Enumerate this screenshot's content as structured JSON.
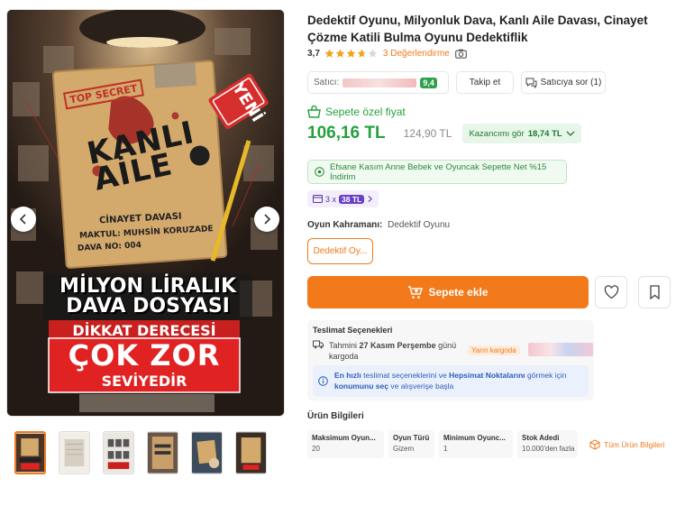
{
  "product": {
    "title": "Dedektif Oyunu, Milyonluk Dava, Kanlı Aile Davası, Cinayet Çözme Katili Bulma Oyunu Dedektiflik",
    "rating": "3,7",
    "rating_stars": 3.7,
    "reviews_link": "3 Değerlendirme"
  },
  "seller": {
    "label": "Satıcı:",
    "score": "9,4",
    "follow_label": "Takip et",
    "ask_label": "Satıcıya sor (1)"
  },
  "price": {
    "special_label": "Sepete özel fiyat",
    "current": "106,16 TL",
    "old": "124,90 TL",
    "earn_prefix": "Kazancımı gör",
    "earn_amount": "18,74 TL"
  },
  "promo": {
    "text": "Efsane Kasım Anne Bebek ve Oyuncak Sepette Net %15 İndirim"
  },
  "installment": {
    "count": "3 x",
    "amount": "38 TL"
  },
  "variant": {
    "key": "Oyun Kahramanı:",
    "value": "Dedektif Oyunu",
    "option": "Dedektif Oy..."
  },
  "cart": {
    "add_label": "Sepete ekle"
  },
  "delivery": {
    "title": "Teslimat Seçenekleri",
    "date_prefix": "Tahmini",
    "date": "27 Kasım Perşembe",
    "date_suffix": "günü kargoda",
    "tag": "Yarın kargoda",
    "info_strong1": "En hızlı",
    "info_mid": "teslimat seçeneklerini ve",
    "info_strong2": "Hepsimat Noktalarını",
    "info_mid2": "görmek için",
    "info_strong3": "konumunu seç",
    "info_end": "ve alışverişe başla"
  },
  "specs": {
    "title": "Ürün Bilgileri",
    "items": [
      {
        "key": "Maksimum Oyun...",
        "value": "20"
      },
      {
        "key": "Oyun Türü",
        "value": "Gizem"
      },
      {
        "key": "Minimum Oyunc...",
        "value": "1"
      },
      {
        "key": "Stok Adedi",
        "value": "10.000'den fazla"
      }
    ],
    "all_label": "Tüm Ürün Bilgileri"
  },
  "cover": {
    "top_secret": "TOP SECRET",
    "new_badge": "YENİ",
    "title_line1": "KANLI",
    "title_line2": "AİLE",
    "case_title": "CİNAYET DAVASI",
    "victim": "MAKTUL: MUHSİN KORUZADE",
    "case_no": "DAVA NO: 004",
    "headline": "MİLYON LİRALIK DAVA DOSYASI",
    "warning_top": "DİKKAT DERECESİ",
    "warning_main": "ÇOK ZOR",
    "warning_bottom": "SEVİYEDİR"
  },
  "colors": {
    "brand_orange": "#f27a1a",
    "price_green": "#23a23c",
    "install_purple": "#6b3fc6",
    "info_blue": "#2d5eb8"
  },
  "icons": {
    "prev": "chevron-left-icon",
    "next": "chevron-right-icon",
    "camera": "camera-icon",
    "chat": "chat-icon",
    "basket": "basket-icon",
    "heart": "heart-icon",
    "bookmark": "bookmark-icon",
    "truck": "truck-icon",
    "info": "info-icon",
    "box": "box-icon"
  }
}
